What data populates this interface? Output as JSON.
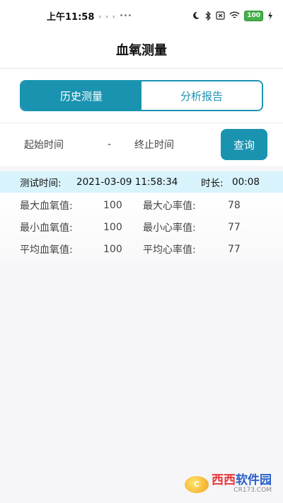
{
  "status_bar": {
    "time": "上午11:58",
    "battery": "100"
  },
  "header": {
    "title": "血氧测量"
  },
  "tabs": [
    {
      "label": "历史测量",
      "active": true
    },
    {
      "label": "分析报告",
      "active": false
    }
  ],
  "query": {
    "start_label": "起始时间",
    "separator": "-",
    "end_label": "终止时间",
    "button_label": "查询"
  },
  "record": {
    "time_label": "测试时间:",
    "datetime": "2021-03-09 11:58:34",
    "duration_label": "时长:",
    "duration": "00:08",
    "stats": [
      {
        "label1": "最大血氧值:",
        "value1": "100",
        "label2": "最大心率值:",
        "value2": "78"
      },
      {
        "label1": "最小血氧值:",
        "value1": "100",
        "label2": "最小心率值:",
        "value2": "77"
      },
      {
        "label1": "平均血氧值:",
        "value1": "100",
        "label2": "平均心率值:",
        "value2": "77"
      }
    ]
  },
  "watermark": {
    "brand_part1": "西西",
    "brand_part2": "软件园",
    "site": "CR173.COM"
  },
  "colors": {
    "accent": "#1a93b0",
    "record_header_bg": "#d8f3fb"
  }
}
